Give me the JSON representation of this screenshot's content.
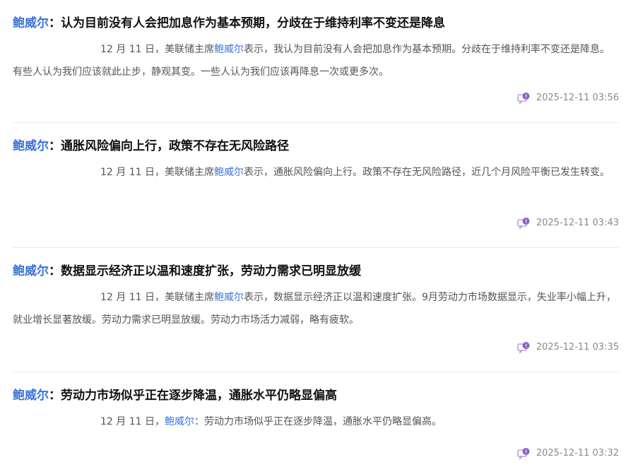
{
  "colors": {
    "accent": "#3a72d6",
    "icon": "#8b5fc7",
    "text": "#555555",
    "title": "#111111"
  },
  "news": [
    {
      "person": "鲍威尔",
      "headline": "：认为目前没有人会把加息作为基本预期，分歧在于维持利率不变还是降息",
      "body_prefix": "12 月 11 日，美联储主席",
      "body_keyword": "鲍威尔",
      "body_suffix": "表示，我认为目前没有人会把加息作为基本预期。分歧在于维持利率不变还是降息。有些人认为我们应该就此止步，静观其变。一些人认为我们应该再降息一次或更多次。",
      "timestamp": "2025-12-11 03:56",
      "icon": "comment-icon"
    },
    {
      "person": "鲍威尔",
      "headline": "：通胀风险偏向上行，政策不存在无风险路径",
      "body_prefix": "12 月 11 日，美联储主席",
      "body_keyword": "鲍威尔",
      "body_suffix": "表示，通胀风险偏向上行。政策不存在无风险路径，近几个月风险平衡已发生转变。",
      "timestamp": "2025-12-11 03:43",
      "icon": "comment-icon"
    },
    {
      "person": "鲍威尔",
      "headline": "：数据显示经济正以温和速度扩张，劳动力需求已明显放缓",
      "body_prefix": "12 月 11 日，美联储主席",
      "body_keyword": "鲍威尔",
      "body_suffix": "表示，数据显示经济正以温和速度扩张。9月劳动力市场数据显示，失业率小幅上升，就业增长显著放缓。劳动力需求已明显放缓。劳动力市场活力减弱，略有疲软。",
      "timestamp": "2025-12-11 03:35",
      "icon": "comment-icon"
    },
    {
      "person": "鲍威尔",
      "headline": "：劳动力市场似乎正在逐步降温，通胀水平仍略显偏高",
      "body_prefix": "12 月 11 日，",
      "body_keyword": "鲍威尔",
      "body_suffix": "：劳动力市场似乎正在逐步降温，通胀水平仍略显偏高。",
      "timestamp": "2025-12-11 03:32",
      "icon": "comment-icon"
    }
  ]
}
